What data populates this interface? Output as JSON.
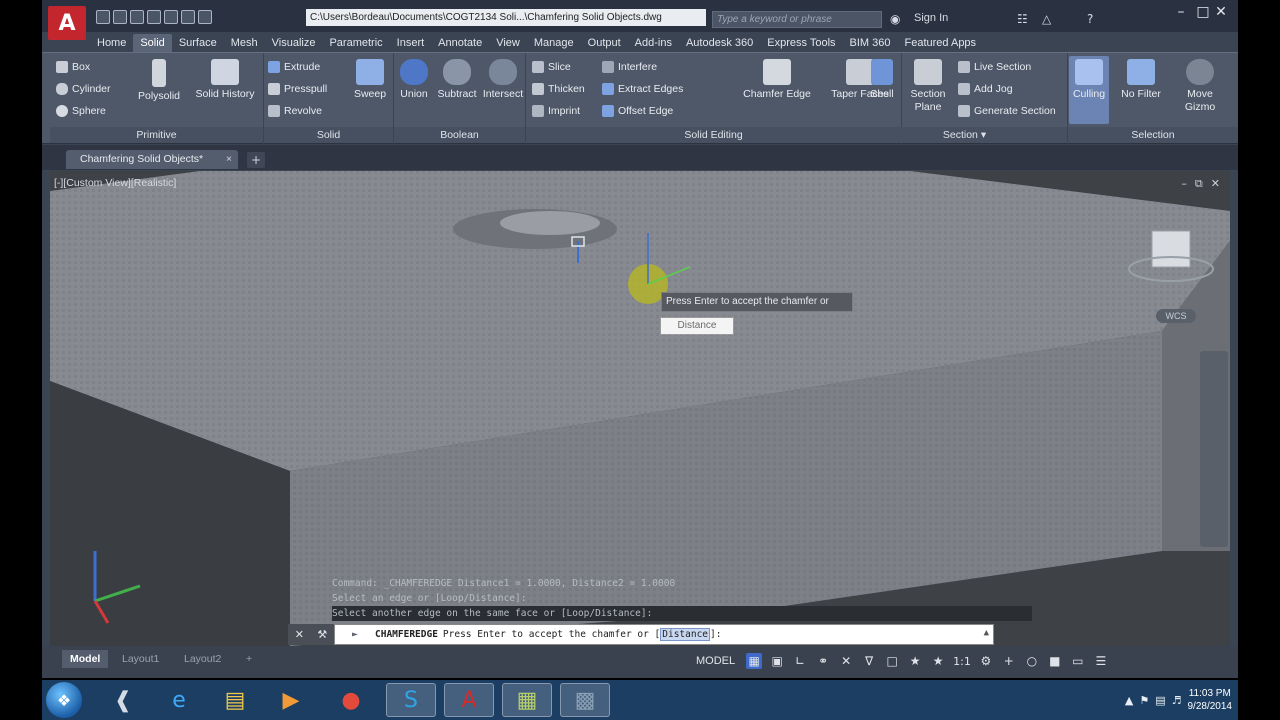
{
  "window": {
    "title": "C:\\Users\\Bordeau\\Documents\\COGT2134 Soli...\\Chamfering Solid Objects.dwg",
    "search_placeholder": "Type a keyword or phrase",
    "signin": "Sign In"
  },
  "ribbon_tabs": [
    "Home",
    "Solid",
    "Surface",
    "Mesh",
    "Visualize",
    "Parametric",
    "Insert",
    "Annotate",
    "View",
    "Manage",
    "Output",
    "Add-ins",
    "Autodesk 360",
    "Express Tools",
    "BIM 360",
    "Featured Apps"
  ],
  "active_ribbon_tab": "Solid",
  "panels": {
    "primitive": {
      "title": "Primitive",
      "box": "Box",
      "cylinder": "Cylinder",
      "sphere": "Sphere",
      "polysolid": "Polysolid",
      "solid_history": "Solid History"
    },
    "solid": {
      "title": "Solid",
      "extrude": "Extrude",
      "presspull": "Presspull",
      "revolve": "Revolve",
      "sweep": "Sweep"
    },
    "boolean": {
      "title": "Boolean",
      "union": "Union",
      "subtract": "Subtract",
      "intersect": "Intersect"
    },
    "solid_editing": {
      "title": "Solid Editing",
      "slice": "Slice",
      "thicken": "Thicken",
      "imprint": "Imprint",
      "interfere": "Interfere",
      "extract_edges": "Extract Edges",
      "offset_edge": "Offset Edge",
      "chamfer_edge": "Chamfer Edge",
      "taper_faces": "Taper Faces",
      "shell": "Shell"
    },
    "section": {
      "title": "Section",
      "section_plane_1": "Section",
      "section_plane_2": "Plane",
      "live_section": "Live Section",
      "add_jog": "Add Jog",
      "generate_section": "Generate Section"
    },
    "selection": {
      "title": "Selection",
      "culling": "Culling",
      "no_filter": "No Filter",
      "move_gizmo_1": "Move",
      "move_gizmo_2": "Gizmo"
    }
  },
  "doc_tab": "Chamfering Solid Objects*",
  "viewport": {
    "label": "[-][Custom View][Realistic]",
    "tooltip": "Press Enter to accept the chamfer or",
    "distance_field": "Distance",
    "wcs": "WCS"
  },
  "command": {
    "history": [
      "Command: _CHAMFEREDGE Distance1 = 1.0000, Distance2 = 1.0000",
      "Select an edge or [Loop/Distance]:",
      "Select another edge on the same face or [Loop/Distance]:"
    ],
    "name": "CHAMFEREDGE",
    "prompt_pre": "Press Enter to accept the chamfer or [",
    "prompt_opt": "Distance",
    "prompt_post": "]:"
  },
  "layout_tabs": [
    "Model",
    "Layout1",
    "Layout2"
  ],
  "status": {
    "model": "MODEL",
    "scale": "1:1"
  },
  "taskbar": {
    "time": "11:03 PM",
    "date": "9/28/2014"
  },
  "colors": {
    "accent": "#3e6bc9",
    "ribbon": "#4e5868",
    "app_red": "#c4262e"
  }
}
